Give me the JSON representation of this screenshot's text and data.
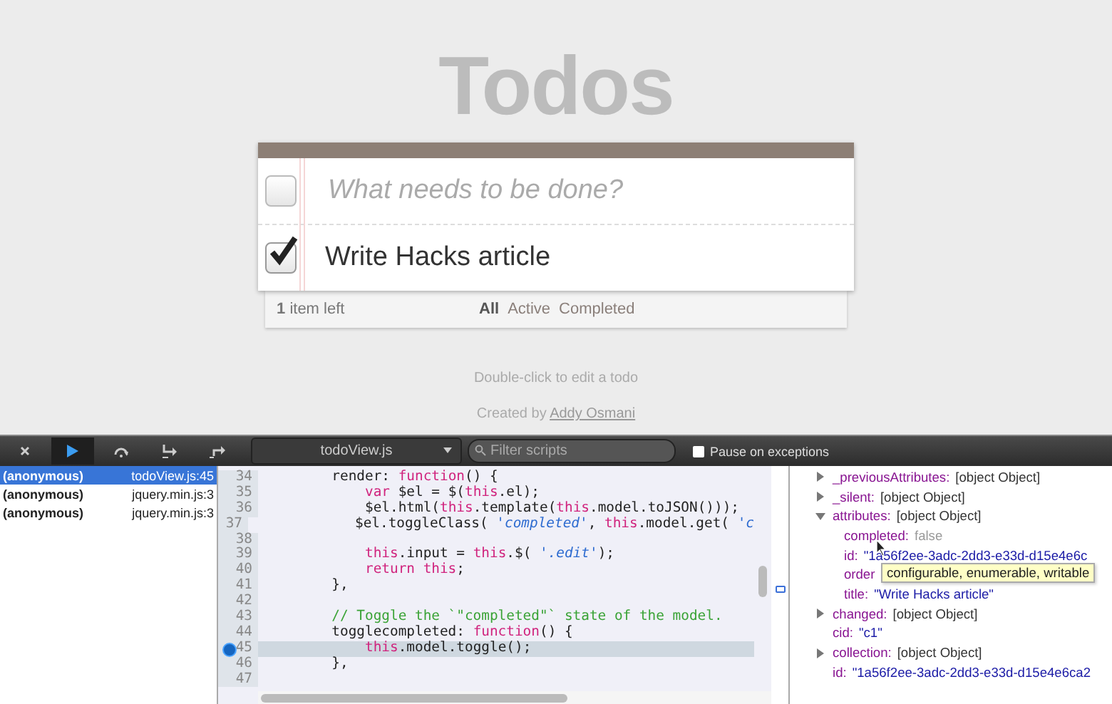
{
  "page": {
    "title": "Todos",
    "new_todo": {
      "placeholder": "What needs to be done?",
      "toggle_all_checked": false
    },
    "todos": [
      {
        "title": "Write Hacks article",
        "completed": true
      }
    ],
    "footer": {
      "count": "1",
      "count_label": "item left",
      "filters": [
        {
          "label": "All",
          "selected": true
        },
        {
          "label": "Active",
          "selected": false
        },
        {
          "label": "Completed",
          "selected": false
        }
      ]
    },
    "info": "Double-click to edit a todo",
    "credit": {
      "text": "Created by",
      "link": "Addy Osmani"
    }
  },
  "devtools": {
    "script_select": "todoView.js",
    "filter": {
      "placeholder": "Filter scripts"
    },
    "pause_on_exceptions": {
      "label": "Pause on exceptions",
      "checked": false
    },
    "call_stack": [
      {
        "function": "(anonymous)",
        "location": "todoView.js:45",
        "selected": true
      },
      {
        "function": "(anonymous)",
        "location": "jquery.min.js:3",
        "selected": false
      },
      {
        "function": "(anonymous)",
        "location": "jquery.min.js:3",
        "selected": false
      }
    ],
    "code": [
      {
        "number": "34",
        "breakpoint": false,
        "current": false,
        "tokens": [
          {
            "kind": "plain",
            "text": "        render: "
          },
          {
            "kind": "keyword",
            "text": "function"
          },
          {
            "kind": "plain",
            "text": "() {"
          }
        ]
      },
      {
        "number": "35",
        "breakpoint": false,
        "current": false,
        "tokens": [
          {
            "kind": "keyword",
            "text": "            var"
          },
          {
            "kind": "plain",
            "text": " $el = $("
          },
          {
            "kind": "keyword",
            "text": "this"
          },
          {
            "kind": "plain",
            "text": ".el);"
          }
        ]
      },
      {
        "number": "36",
        "breakpoint": false,
        "current": false,
        "tokens": [
          {
            "kind": "plain",
            "text": "            $el.html("
          },
          {
            "kind": "keyword",
            "text": "this"
          },
          {
            "kind": "plain",
            "text": ".template("
          },
          {
            "kind": "keyword",
            "text": "this"
          },
          {
            "kind": "plain",
            "text": ".model.toJSON()));"
          }
        ]
      },
      {
        "number": "37",
        "breakpoint": false,
        "current": false,
        "tokens": [
          {
            "kind": "plain",
            "text": "            $el.toggleClass( "
          },
          {
            "kind": "string",
            "text": "'completed'"
          },
          {
            "kind": "plain",
            "text": ", "
          },
          {
            "kind": "keyword",
            "text": "this"
          },
          {
            "kind": "plain",
            "text": ".model.get( "
          },
          {
            "kind": "string",
            "text": "'c"
          }
        ]
      },
      {
        "number": "38",
        "breakpoint": false,
        "current": false
      },
      {
        "number": "39",
        "breakpoint": false,
        "current": false,
        "tokens": [
          {
            "kind": "keyword",
            "text": "            this"
          },
          {
            "kind": "plain",
            "text": ".input = "
          },
          {
            "kind": "keyword",
            "text": "this"
          },
          {
            "kind": "plain",
            "text": ".$( "
          },
          {
            "kind": "string",
            "text": "'.edit'"
          },
          {
            "kind": "plain",
            "text": ");"
          }
        ]
      },
      {
        "number": "40",
        "breakpoint": false,
        "current": false,
        "tokens": [
          {
            "kind": "keyword",
            "text": "            return this"
          },
          {
            "kind": "plain",
            "text": ";"
          }
        ]
      },
      {
        "number": "41",
        "breakpoint": false,
        "current": false,
        "tokens": [
          {
            "kind": "plain",
            "text": "        },"
          }
        ]
      },
      {
        "number": "42",
        "breakpoint": false,
        "current": false
      },
      {
        "number": "43",
        "breakpoint": false,
        "current": false,
        "tokens": [
          {
            "kind": "comment",
            "text": "        // Toggle the `\"completed\"` state of the model."
          }
        ]
      },
      {
        "number": "44",
        "breakpoint": false,
        "current": false,
        "tokens": [
          {
            "kind": "plain",
            "text": "        togglecompleted: "
          },
          {
            "kind": "keyword",
            "text": "function"
          },
          {
            "kind": "plain",
            "text": "() {"
          }
        ]
      },
      {
        "number": "45",
        "breakpoint": true,
        "current": true,
        "tokens": [
          {
            "kind": "keyword",
            "text": "            this"
          },
          {
            "kind": "plain",
            "text": ".model.toggle();"
          }
        ]
      },
      {
        "number": "46",
        "breakpoint": false,
        "current": false,
        "tokens": [
          {
            "kind": "plain",
            "text": "        },"
          }
        ]
      },
      {
        "number": "47",
        "breakpoint": false,
        "current": false
      }
    ],
    "scope": [
      {
        "name": "_previousAttributes:",
        "value": "[object Object]",
        "kind": "object",
        "expanded": false
      },
      {
        "name": "_silent:",
        "value": "[object Object]",
        "kind": "object",
        "expanded": false
      },
      {
        "name": "attributes:",
        "value": "[object Object]",
        "kind": "object",
        "expanded": true,
        "children": [
          {
            "name": "completed:",
            "value": "false",
            "kind": "boolean"
          },
          {
            "name": "id:",
            "value": "\"1a56f2ee-3adc-2dd3-e33d-d15e4e6c",
            "kind": "string"
          },
          {
            "name": "order",
            "kind": "hidden"
          },
          {
            "name": "title:",
            "value": "\"Write Hacks article\"",
            "kind": "string"
          }
        ]
      },
      {
        "name": "changed:",
        "value": "[object Object]",
        "kind": "object",
        "expanded": false
      },
      {
        "name": "cid:",
        "value": "\"c1\"",
        "kind": "string"
      },
      {
        "name": "collection:",
        "value": "[object Object]",
        "kind": "object",
        "expanded": false
      },
      {
        "name": "id:",
        "value": "\"1a56f2ee-3adc-2dd3-e33d-d15e4e6ca2",
        "kind": "string"
      }
    ],
    "tooltip": "configurable, enumerable, writable"
  }
}
